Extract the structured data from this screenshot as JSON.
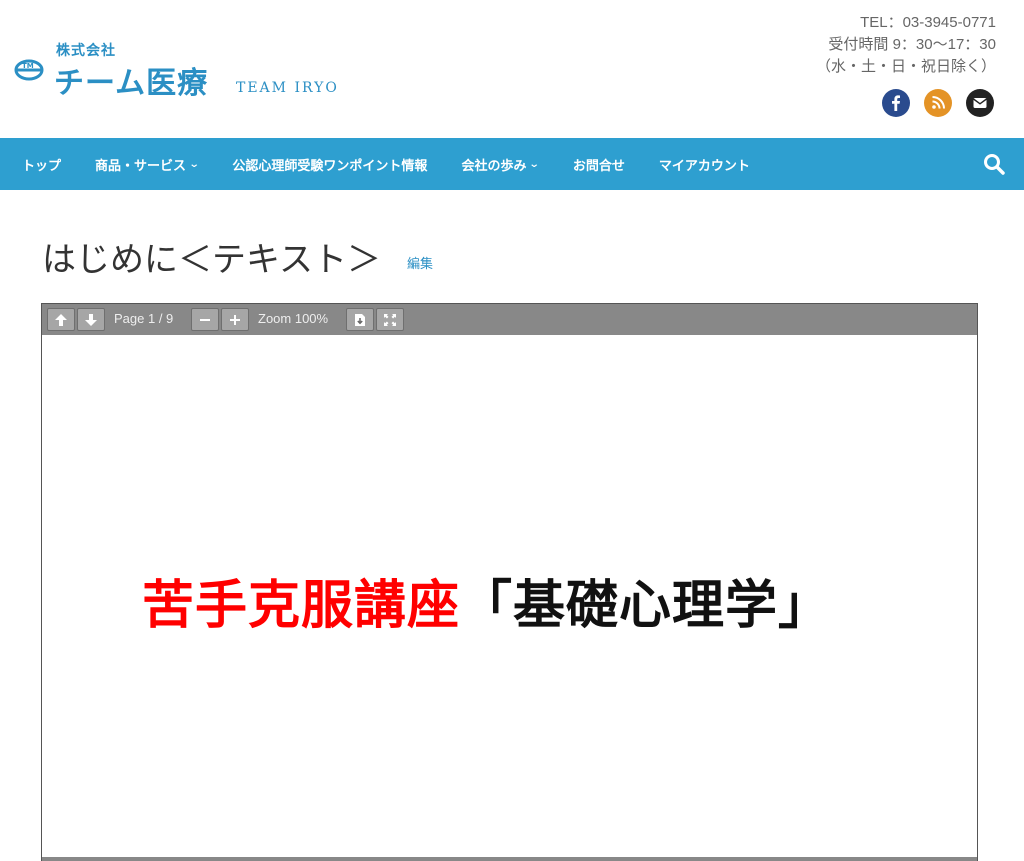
{
  "header": {
    "logo": {
      "company_prefix": "株式会社",
      "company_name": "チーム医療",
      "english_name": "TEAM IRYO"
    },
    "contact": {
      "tel": "TEL：03-3945-0771",
      "hours": "受付時間 9：30〜17：30",
      "closed": "（水・土・日・祝日除く）"
    },
    "social": [
      {
        "name": "facebook-icon",
        "color": "#2a4b8e"
      },
      {
        "name": "rss-icon",
        "color": "#e49326"
      },
      {
        "name": "mail-icon",
        "color": "#222222"
      }
    ]
  },
  "nav": {
    "accent": "#2e9fd0",
    "items": [
      {
        "label": "トップ",
        "dropdown": false
      },
      {
        "label": "商品・サービス",
        "dropdown": true
      },
      {
        "label": "公認心理師受験ワンポイント情報",
        "dropdown": false
      },
      {
        "label": "会社の歩み",
        "dropdown": true
      },
      {
        "label": "お問合せ",
        "dropdown": false
      },
      {
        "label": "マイアカウント",
        "dropdown": false
      }
    ],
    "search_icon": "search-icon"
  },
  "page": {
    "title": "はじめに＜テキスト＞",
    "edit_label": "編集"
  },
  "viewer": {
    "page_indicator": "Page 1 / 9",
    "zoom_label": "Zoom 100%",
    "document": {
      "heading_red": "苦手克服講座",
      "heading_black": "「基礎心理学」"
    }
  }
}
